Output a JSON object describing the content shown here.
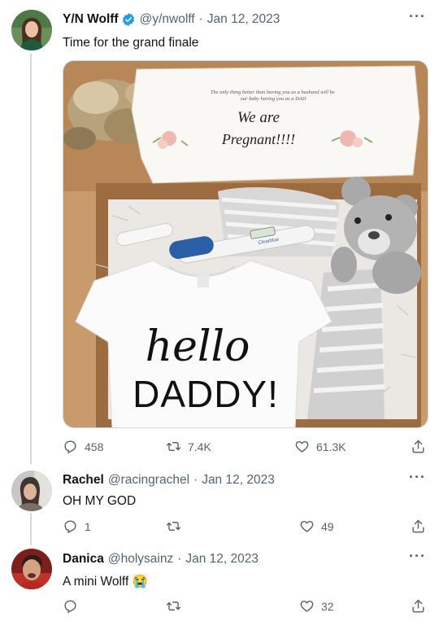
{
  "tweets": [
    {
      "name": "Y/N Wolff",
      "handle": "@y/nwolff",
      "date": "Jan 12, 2023",
      "text": "Time for the grand finale",
      "replies": "458",
      "retweets": "7.4K",
      "likes": "61.3K",
      "verified": true
    },
    {
      "name": "Rachel",
      "handle": "@racingrachel",
      "date": "Jan 12, 2023",
      "text": "OH MY GOD",
      "replies": "1",
      "retweets": "",
      "likes": "49"
    },
    {
      "name": "Danica",
      "handle": "@holysainz",
      "date": "Jan 12, 2023",
      "text": "A mini Wolff 😭",
      "replies": "",
      "retweets": "",
      "likes": "32"
    }
  ],
  "photo": {
    "card_small_text": "The only thing better than having you as a husband will be our baby having you as a DAD",
    "card_line1": "We are",
    "card_line2": "Pregnant!!!!",
    "onesie_line1": "hello",
    "onesie_line2": "DADDY!",
    "test_brand": "Clearblue"
  },
  "separator": "·",
  "more_glyph": "···",
  "colors": {
    "accent": "#1d9bf0",
    "muted": "#536471",
    "line": "#cfd9de"
  }
}
